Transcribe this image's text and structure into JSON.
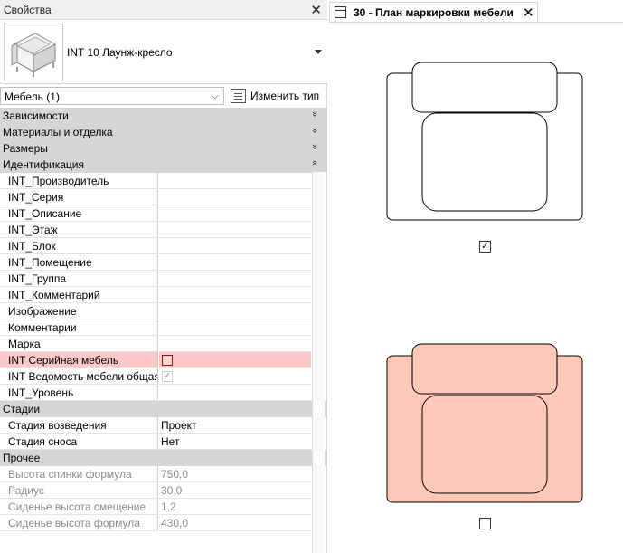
{
  "properties_panel": {
    "title": "Свойства",
    "close_glyph": "✕",
    "type_name": "INT 10 Лаунж-кресло",
    "filter_value": "Мебель (1)",
    "filter_chevron": "⌵",
    "edit_type_label": "Изменить тип",
    "categories": {
      "constraints": "Зависимости",
      "materials": "Материалы и отделка",
      "dimensions": "Размеры",
      "identity": "Идентификация",
      "phasing": "Стадии",
      "other": "Прочее"
    },
    "chevron_collapsed": "»",
    "chevron_expanded": "«",
    "identity_rows": [
      {
        "name": "INT_Производитель",
        "value": ""
      },
      {
        "name": "INT_Серия",
        "value": ""
      },
      {
        "name": "INT_Описание",
        "value": ""
      },
      {
        "name": "INT_Этаж",
        "value": ""
      },
      {
        "name": "INT_Блок",
        "value": ""
      },
      {
        "name": "INT_Помещение",
        "value": ""
      },
      {
        "name": "INT_Группа",
        "value": ""
      },
      {
        "name": "INT_Комментарий",
        "value": ""
      },
      {
        "name": "Изображение",
        "value": ""
      },
      {
        "name": "Комментарии",
        "value": ""
      },
      {
        "name": "Марка",
        "value": ""
      },
      {
        "name": "INT Серийная мебель",
        "value": "",
        "checked": false,
        "highlighted": true
      },
      {
        "name": "INT Ведомость мебели общая",
        "value": "",
        "checked": true,
        "disabled": true
      },
      {
        "name": "INT_Уровень",
        "value": ""
      }
    ],
    "phasing_rows": [
      {
        "name": "Стадия возведения",
        "value": "Проект"
      },
      {
        "name": "Стадия сноса",
        "value": "Нет"
      }
    ],
    "other_rows": [
      {
        "name": "Высота спинки формула",
        "value": "750,0"
      },
      {
        "name": "Радиус",
        "value": "30,0"
      },
      {
        "name": "Сиденье высота смещение",
        "value": "1,2"
      },
      {
        "name": "Сиденье высота формула",
        "value": "430,0"
      }
    ],
    "checkmark_glyph": "✓"
  },
  "view": {
    "tab_label": "30 - План маркировки мебели",
    "tab_close_glyph": "✕",
    "chair_top": {
      "fill": "#ffffff",
      "checked": true
    },
    "chair_bottom": {
      "fill": "#ffc8b8",
      "checked": false
    },
    "check_glyph": "✓"
  },
  "colors": {
    "highlight_row": "#ffc8c8",
    "category_bg": "#d6d6d6",
    "chair_fill_selected": "#ffc8b8"
  }
}
